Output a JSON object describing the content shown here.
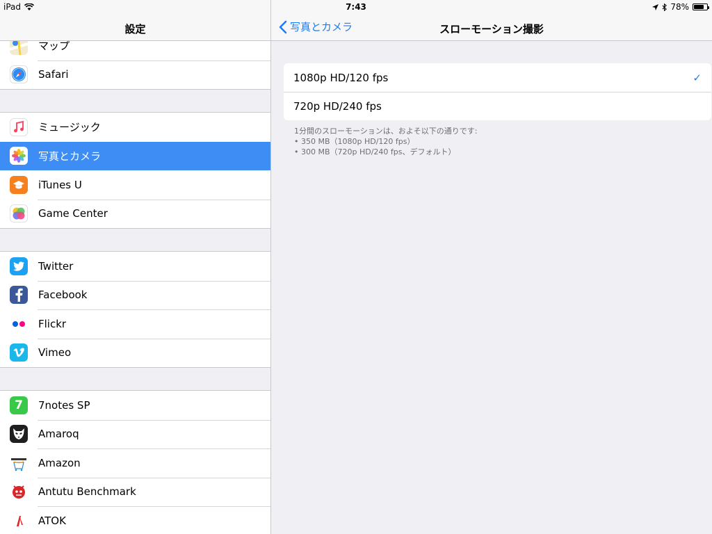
{
  "status_bar": {
    "device": "iPad",
    "time": "7:43",
    "battery": "78%",
    "battery_level": 0.78
  },
  "left_nav": {
    "title": "設定"
  },
  "groups": [
    {
      "items": [
        {
          "label": "マップ",
          "icon": "maps-icon"
        },
        {
          "label": "Safari",
          "icon": "safari-icon"
        }
      ]
    },
    {
      "items": [
        {
          "label": "ミュージック",
          "icon": "music-icon"
        },
        {
          "label": "写真とカメラ",
          "icon": "photos-icon",
          "selected": true
        },
        {
          "label": "iTunes U",
          "icon": "itunes-u-icon"
        },
        {
          "label": "Game Center",
          "icon": "game-center-icon"
        }
      ]
    },
    {
      "items": [
        {
          "label": "Twitter",
          "icon": "twitter-icon"
        },
        {
          "label": "Facebook",
          "icon": "facebook-icon"
        },
        {
          "label": "Flickr",
          "icon": "flickr-icon"
        },
        {
          "label": "Vimeo",
          "icon": "vimeo-icon"
        }
      ]
    },
    {
      "items": [
        {
          "label": "7notes SP",
          "icon": "7notes-icon"
        },
        {
          "label": "Amaroq",
          "icon": "amaroq-icon"
        },
        {
          "label": "Amazon",
          "icon": "amazon-icon"
        },
        {
          "label": "Antutu Benchmark",
          "icon": "antutu-icon"
        },
        {
          "label": "ATOK",
          "icon": "atok-icon"
        }
      ]
    }
  ],
  "right_nav": {
    "back_label": "写真とカメラ",
    "title": "スローモーション撮影"
  },
  "options": [
    {
      "label": "1080p HD/120 fps",
      "checked": true
    },
    {
      "label": "720p HD/240 fps",
      "checked": false
    }
  ],
  "footer": {
    "line1": "1分間のスローモーションは、およそ以下の通りです:",
    "line2": "• 350 MB（1080p HD/120 fps）",
    "line3": "• 300 MB（720p HD/240 fps、デフォルト）"
  },
  "colors": {
    "accent": "#1a7cf8",
    "selected_row": "#3d8df5",
    "background": "#efeff4"
  }
}
